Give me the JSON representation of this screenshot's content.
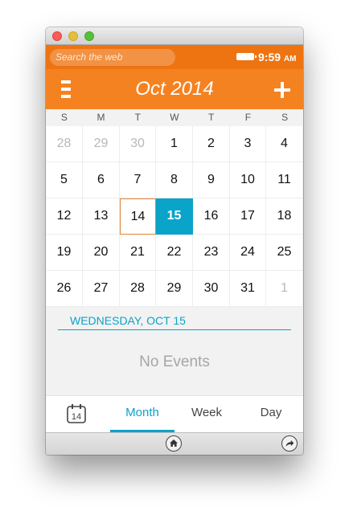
{
  "status_bar": {
    "search_placeholder": "Search the web",
    "time": "9:59",
    "ampm": "AM",
    "battery_icon": "battery-icon"
  },
  "header": {
    "title": "Oct 2014",
    "menu_icon": "menu-icon",
    "add_icon": "plus-icon",
    "background_color": "#f58220"
  },
  "weekdays": [
    "S",
    "M",
    "T",
    "W",
    "T",
    "F",
    "S"
  ],
  "calendar": {
    "today": "14",
    "selected": "15",
    "accent_color": "#0aa3c9",
    "weeks": [
      [
        {
          "d": "28",
          "other": true
        },
        {
          "d": "29",
          "other": true
        },
        {
          "d": "30",
          "other": true
        },
        {
          "d": "1"
        },
        {
          "d": "2"
        },
        {
          "d": "3"
        },
        {
          "d": "4"
        }
      ],
      [
        {
          "d": "5"
        },
        {
          "d": "6"
        },
        {
          "d": "7"
        },
        {
          "d": "8"
        },
        {
          "d": "9"
        },
        {
          "d": "10"
        },
        {
          "d": "11"
        }
      ],
      [
        {
          "d": "12"
        },
        {
          "d": "13"
        },
        {
          "d": "14",
          "today": true
        },
        {
          "d": "15",
          "selected": true
        },
        {
          "d": "16"
        },
        {
          "d": "17"
        },
        {
          "d": "18"
        }
      ],
      [
        {
          "d": "19"
        },
        {
          "d": "20"
        },
        {
          "d": "21"
        },
        {
          "d": "22"
        },
        {
          "d": "23"
        },
        {
          "d": "24"
        },
        {
          "d": "25"
        }
      ],
      [
        {
          "d": "26"
        },
        {
          "d": "27"
        },
        {
          "d": "28"
        },
        {
          "d": "29"
        },
        {
          "d": "30"
        },
        {
          "d": "31"
        },
        {
          "d": "1",
          "other": true
        }
      ]
    ]
  },
  "events": {
    "day_heading": "WEDNESDAY, OCT 15",
    "empty_text": "No Events"
  },
  "tabs": {
    "today_icon_number": "14",
    "month": "Month",
    "week": "Week",
    "day": "Day",
    "active": "Month"
  },
  "browser_bar": {
    "home_icon": "home-icon",
    "share_icon": "share-icon"
  }
}
